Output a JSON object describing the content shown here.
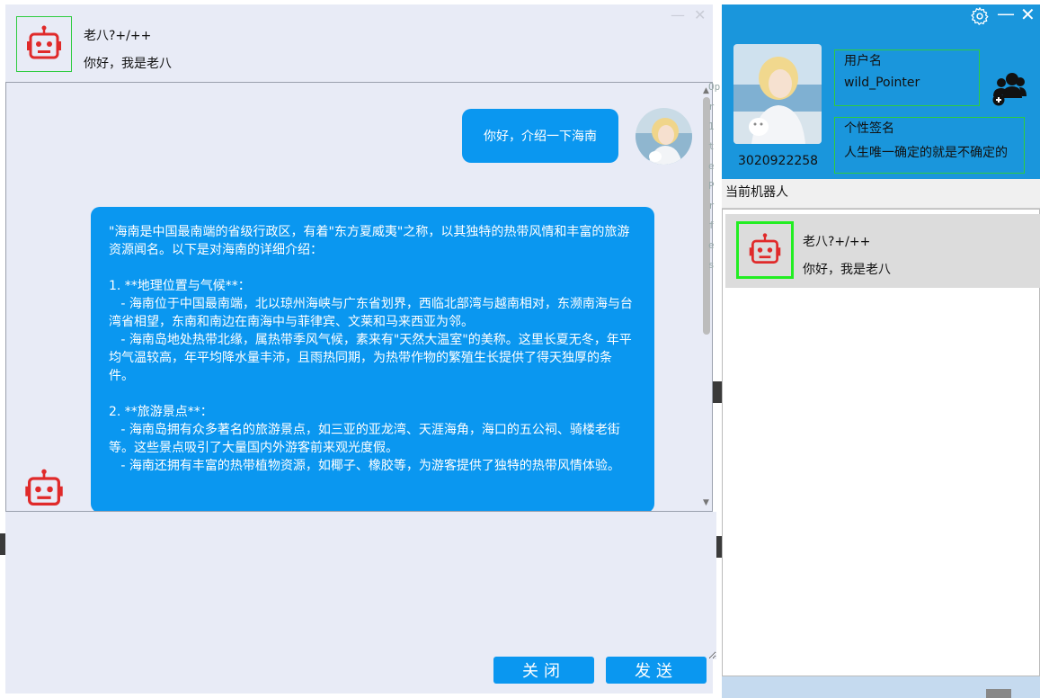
{
  "chat": {
    "bot_name": "老八?+/++",
    "bot_greeting": "你好，我是老八",
    "user_message": "你好，介绍一下海南",
    "bot_reply": "\"海南是中国最南端的省级行政区，有着\"东方夏威夷\"之称，以其独特的热带风情和丰富的旅游资源闻名。以下是对海南的详细介绍：\n\n1. **地理位置与气候**：\n   - 海南位于中国最南端，北以琼州海峡与广东省划界，西临北部湾与越南相对，东濒南海与台湾省相望，东南和南边在南海中与菲律宾、文莱和马来西亚为邻。\n   - 海南岛地处热带北缘，属热带季风气候，素来有\"天然大温室\"的美称。这里长夏无冬，年平均气温较高，年平均降水量丰沛，且雨热同期，为热带作物的繁殖生长提供了得天独厚的条件。\n\n2. **旅游景点**：\n   - 海南岛拥有众多著名的旅游景点，如三亚的亚龙湾、天涯海角，海口的五公祠、骑楼老街等。这些景点吸引了大量国内外游客前来观光度假。\n   - 海南还拥有丰富的热带植物资源，如椰子、橡胶等，为游客提供了独特的热带风情体验。",
    "close_label": "关闭",
    "send_label": "发送",
    "input_value": ""
  },
  "profile": {
    "username_label": "用户名",
    "username": "wild_Pointer",
    "signature_label": "个性签名",
    "signature": "人生唯一确定的就是不确定的",
    "user_id": "3020922258"
  },
  "robots": {
    "section_title": "当前机器人",
    "items": [
      {
        "name": "老八?+/++",
        "status": "你好，我是老八"
      }
    ]
  },
  "icons": {
    "robot": "robot-icon",
    "settings": "gear-icon",
    "friends": "add-friends-icon"
  },
  "colors": {
    "accent": "#0a97f0",
    "panel_blue": "#1a96dc",
    "robot_red": "#e02a2a",
    "frame_green": "#2ecc40"
  }
}
